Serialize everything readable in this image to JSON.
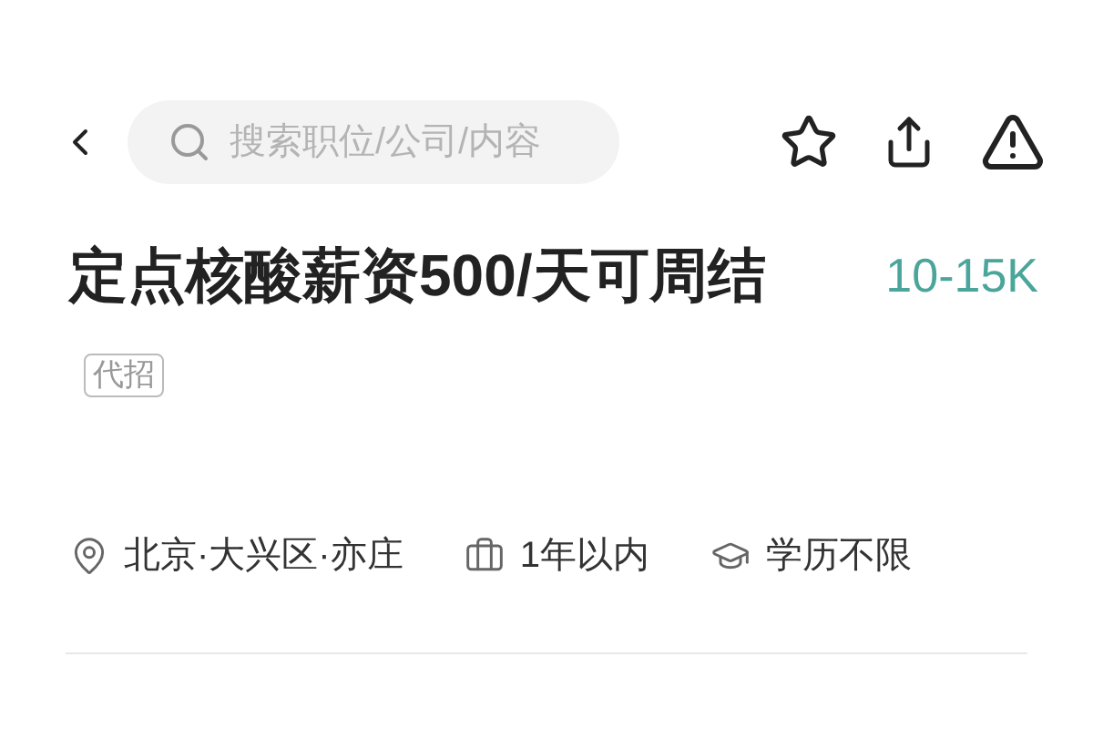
{
  "search": {
    "placeholder": "搜索职位/公司/内容"
  },
  "job": {
    "title": "定点核酸薪资500/天可周结",
    "tag": "代招",
    "salary": "10-15K"
  },
  "details": [
    {
      "kind": "location",
      "text": "北京·大兴区·亦庄"
    },
    {
      "kind": "experience",
      "text": "1年以内"
    },
    {
      "kind": "education",
      "text": "学历不限"
    }
  ]
}
